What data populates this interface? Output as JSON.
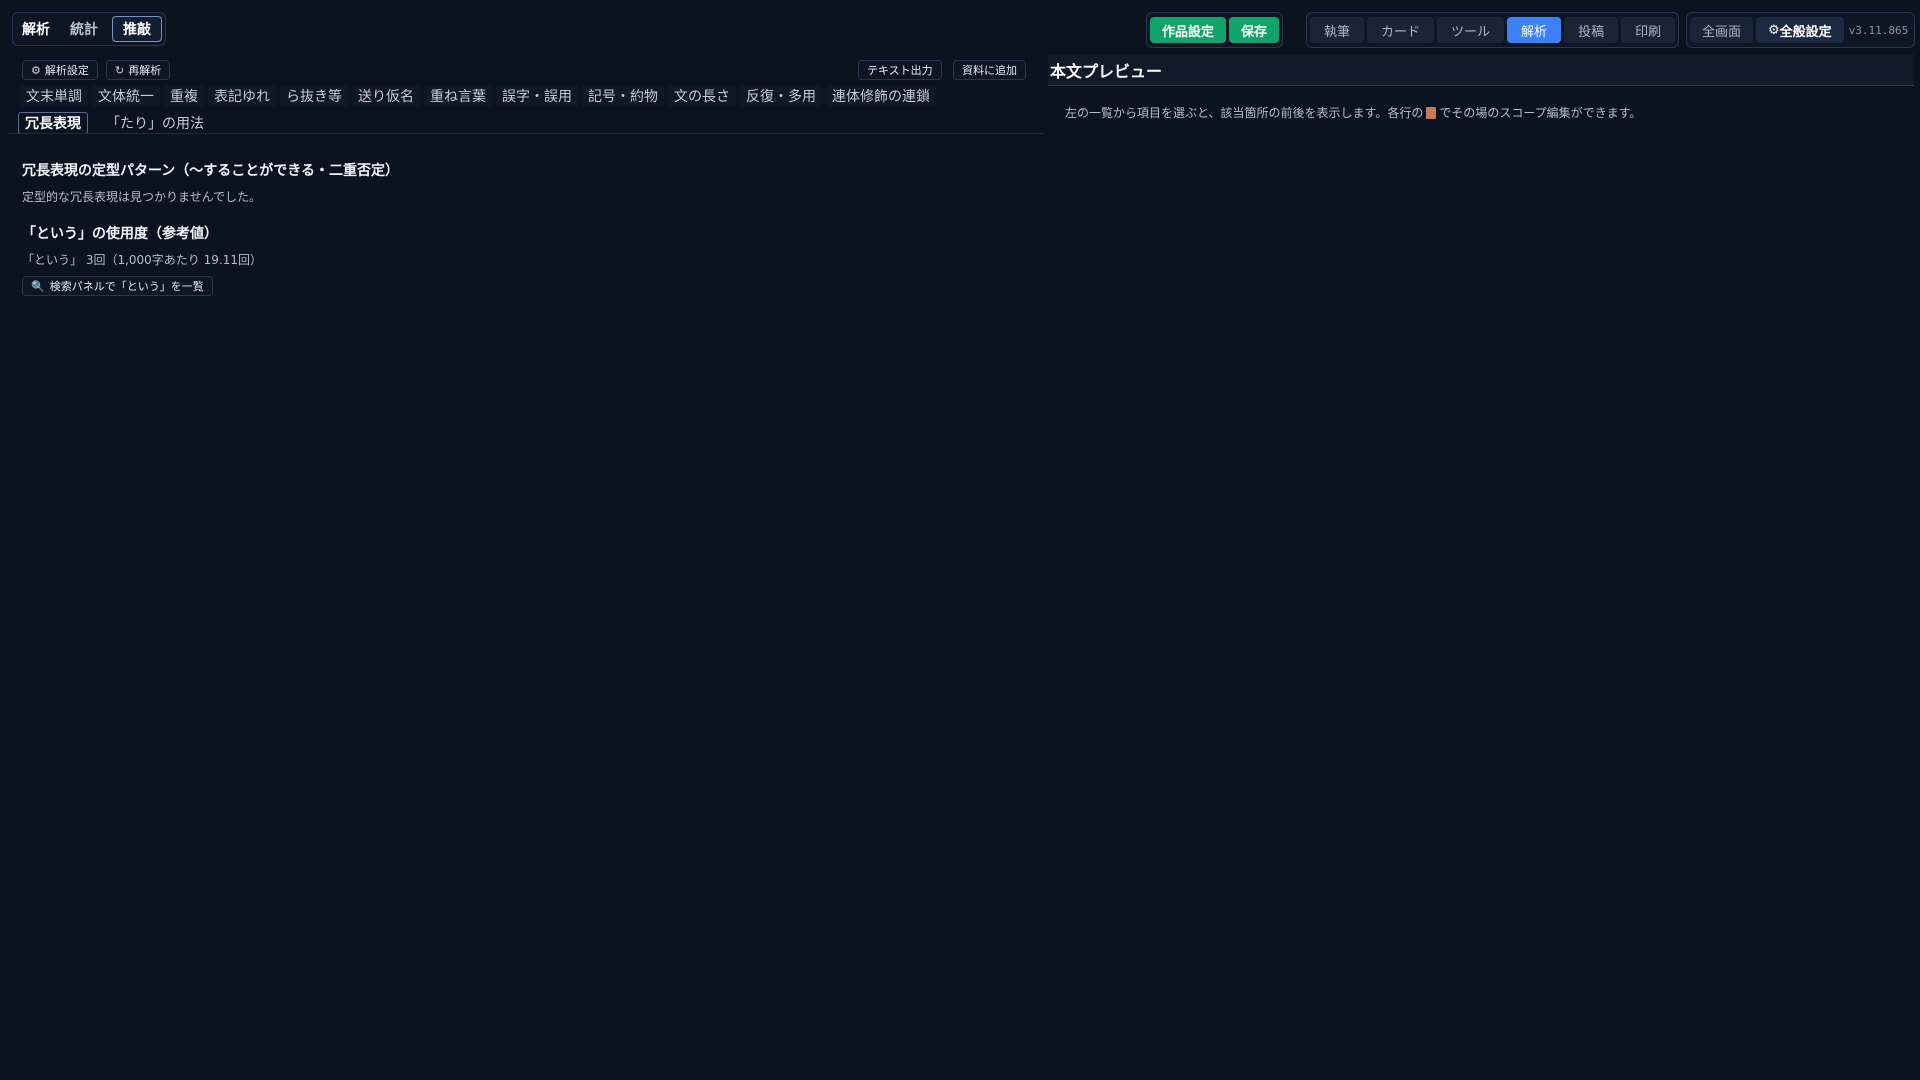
{
  "top_left_tabs": [
    {
      "label": "解析",
      "active": false
    },
    {
      "label": "統計",
      "active": false
    },
    {
      "label": "推敲",
      "active": true
    }
  ],
  "project": {
    "settings_label": "作品設定",
    "save_label": "保存"
  },
  "modes": [
    {
      "label": "執筆",
      "active": false
    },
    {
      "label": "カード",
      "active": false
    },
    {
      "label": "ツール",
      "active": false
    },
    {
      "label": "解析",
      "active": true
    },
    {
      "label": "投稿",
      "active": false
    },
    {
      "label": "印刷",
      "active": false
    }
  ],
  "global": {
    "fullscreen_label": "全画面",
    "settings_label": "全般設定",
    "settings_icon": "gear-icon",
    "version": "v3.11.865"
  },
  "toolbar": {
    "analysis_settings": "解析設定",
    "analysis_settings_icon": "gear-icon",
    "reanalyze": "再解析",
    "reanalyze_icon": "refresh-icon",
    "export_text": "テキスト出力",
    "add_to_material": "資料に追加"
  },
  "check_tabs_row1": [
    "文末単調",
    "文体統一",
    "重複",
    "表記ゆれ",
    "ら抜き等",
    "送り仮名",
    "重ね言葉",
    "誤字・誤用",
    "記号・約物",
    "文の長さ",
    "反復・多用",
    "連体修飾の連鎖"
  ],
  "check_tabs_row2": [
    {
      "label": "冗長表現",
      "active": true
    },
    {
      "label": "「たり」の用法",
      "active": false
    }
  ],
  "redundancy": {
    "title": "冗長表現の定型パターン（〜することができる・二重否定）",
    "result": "定型的な冗長表現は見つかりませんでした。"
  },
  "toiu": {
    "title": "「という」の使用度（参考値）",
    "stat": "「という」 3回（1,000字あたり 19.11回）",
    "search_button": "検索パネルで「という」を一覧",
    "search_icon": "magnifier-icon"
  },
  "preview": {
    "title": "本文プレビュー",
    "hint_before": "左の一覧から項目を選ぶと、該当箇所の前後を表示します。各行の",
    "hint_icon": "document-icon",
    "hint_after": "でその場のスコープ編集ができます。"
  }
}
